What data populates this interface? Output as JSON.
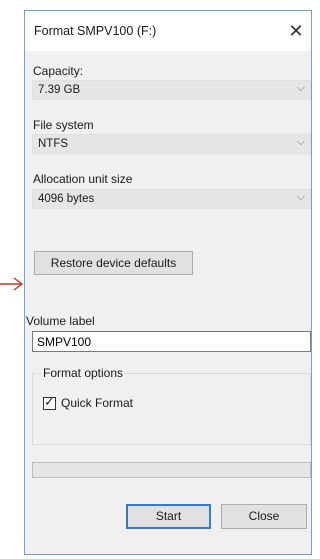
{
  "window": {
    "title": "Format SMPV100 (F:)",
    "close_glyph": "✕"
  },
  "capacity": {
    "label": "Capacity:",
    "value": "7.39 GB"
  },
  "file_system": {
    "label": "File system",
    "value": "NTFS"
  },
  "allocation": {
    "label": "Allocation unit size",
    "value": "4096 bytes"
  },
  "restore_button": {
    "label": "Restore device defaults"
  },
  "volume_label": {
    "label": "Volume label",
    "value": "SMPV100"
  },
  "format_options": {
    "title": "Format options",
    "quick_format_label": "Quick Format",
    "quick_format_checked": true,
    "check_glyph": "✓"
  },
  "progress": {
    "value": 0
  },
  "buttons": {
    "start": "Start",
    "close": "Close"
  },
  "icons": {
    "combo_chevron": "chevron-down-icon",
    "pointer_arrow": "arrow-right-icon"
  },
  "colors": {
    "arrow": "#c0392b",
    "border": "#7aa0c8"
  }
}
